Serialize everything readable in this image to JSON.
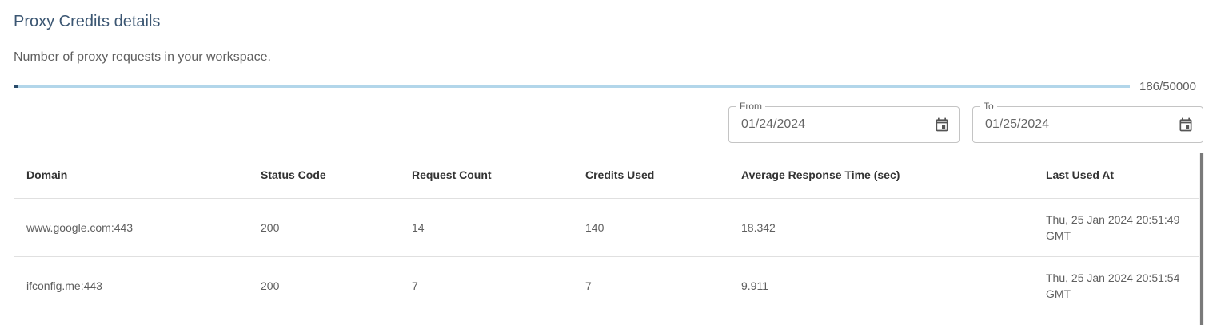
{
  "header": {
    "title": "Proxy Credits details",
    "subtitle": "Number of proxy requests in your workspace."
  },
  "usage": {
    "used": 186,
    "total": 50000,
    "label": "186/50000",
    "fill_color": "#2a4b6a",
    "track_color": "#b2d6ea"
  },
  "filters": {
    "from": {
      "label": "From",
      "value": "01/24/2024",
      "icon": "calendar-icon"
    },
    "to": {
      "label": "To",
      "value": "01/25/2024",
      "icon": "calendar-icon"
    }
  },
  "table": {
    "columns": [
      "Domain",
      "Status Code",
      "Request Count",
      "Credits Used",
      "Average Response Time (sec)",
      "Last Used At"
    ],
    "rows": [
      [
        "www.google.com:443",
        "200",
        "14",
        "140",
        "18.342",
        "Thu, 25 Jan 2024 20:51:49 GMT"
      ],
      [
        "ifconfig.me:443",
        "200",
        "7",
        "7",
        "9.911",
        "Thu, 25 Jan 2024 20:51:54 GMT"
      ]
    ]
  }
}
